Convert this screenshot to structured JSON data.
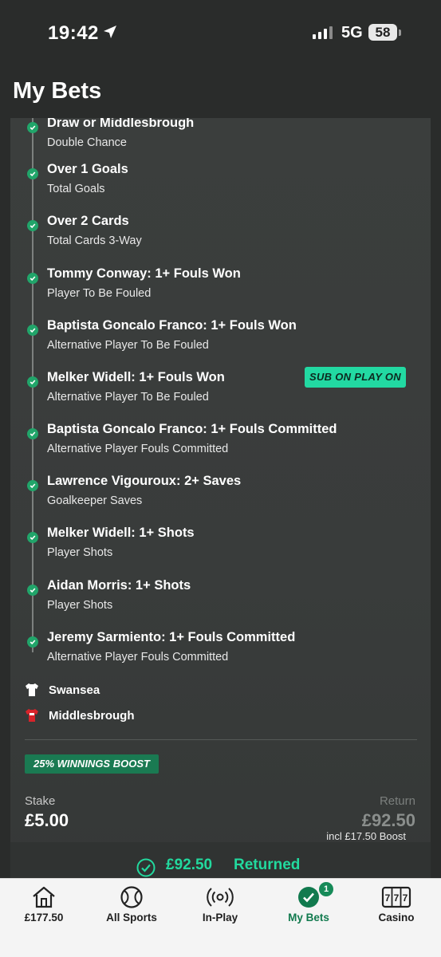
{
  "status": {
    "time": "19:42",
    "network": "5G",
    "battery": "58"
  },
  "header": {
    "title": "My Bets"
  },
  "bet": {
    "legs": [
      {
        "selection": "Draw or Middlesbrough",
        "market": "Double Chance"
      },
      {
        "selection": "Over 1 Goals",
        "market": "Total Goals"
      },
      {
        "selection": "Over 2 Cards",
        "market": "Total Cards 3-Way"
      },
      {
        "selection": "Tommy Conway: 1+ Fouls Won",
        "market": "Player To Be Fouled"
      },
      {
        "selection": "Baptista Goncalo Franco: 1+ Fouls Won",
        "market": "Alternative Player To Be Fouled"
      },
      {
        "selection": "Melker Widell: 1+ Fouls Won",
        "market": "Alternative Player To Be Fouled",
        "badge": "SUB ON PLAY ON"
      },
      {
        "selection": "Baptista Goncalo Franco: 1+ Fouls Committed",
        "market": "Alternative Player Fouls Committed"
      },
      {
        "selection": "Lawrence Vigouroux: 2+ Saves",
        "market": "Goalkeeper Saves"
      },
      {
        "selection": "Melker Widell: 1+ Shots",
        "market": "Player Shots"
      },
      {
        "selection": "Aidan Morris: 1+ Shots",
        "market": "Player Shots"
      },
      {
        "selection": "Jeremy Sarmiento: 1+ Fouls Committed",
        "market": "Alternative Player Fouls Committed"
      }
    ],
    "teams": {
      "home": "Swansea",
      "away": "Middlesbrough"
    },
    "boost_badge": "25% WINNINGS BOOST",
    "stake_label": "Stake",
    "stake_value": "£5.00",
    "return_label": "Return",
    "return_value": "£92.50",
    "boost_note": "incl £17.50 Boost",
    "returned_amount": "£92.50",
    "returned_text": "Returned"
  },
  "colors": {
    "accent_green": "#22d99e",
    "check_green": "#21a56a",
    "badge_green": "#1a7a52",
    "active_tab": "#117a4e"
  },
  "tabbar": {
    "tabs": [
      {
        "label": "£177.50",
        "icon": "home-icon"
      },
      {
        "label": "All Sports",
        "icon": "ball-icon"
      },
      {
        "label": "In-Play",
        "icon": "broadcast-icon"
      },
      {
        "label": "My Bets",
        "icon": "check-circle-icon",
        "badge": "1",
        "active": true
      },
      {
        "label": "Casino",
        "icon": "slot-machine-icon"
      }
    ]
  }
}
